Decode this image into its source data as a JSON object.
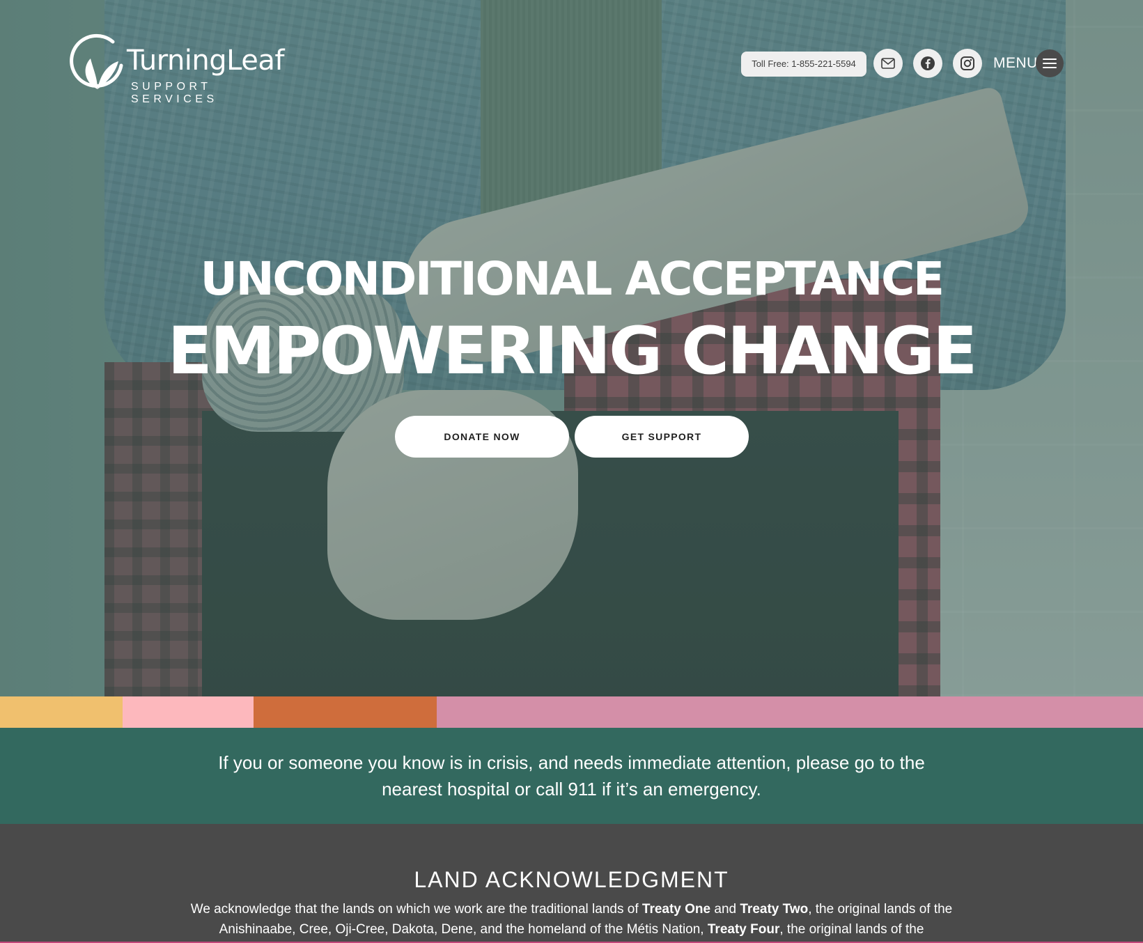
{
  "header": {
    "logo_name": "TurningLeaf",
    "logo_tagline": "SUPPORT SERVICES",
    "toll_free": "Toll Free: 1-855-221-5594",
    "icons": [
      "mail-icon",
      "facebook-icon",
      "instagram-icon"
    ],
    "menu_label": "MENU"
  },
  "hero": {
    "headline_1": "UNCONDITIONAL ACCEPTANCE",
    "headline_2": "EMPOWERING CHANGE",
    "donate_label": "DONATE NOW",
    "support_label": "GET SUPPORT"
  },
  "stripes": {
    "colors": [
      "#f0c06e",
      "#fdb8bd",
      "#cf6d3c",
      "#d48fa8"
    ]
  },
  "crisis": {
    "message": "If you or someone you know is in crisis, and needs immediate attention, please go to the nearest hospital or call 911 if it’s an emergency."
  },
  "land": {
    "title": "LAND ACKNOWLEDGMENT",
    "text_1": "We acknowledge that the lands on which we work are the traditional lands of ",
    "treaty_one": "Treaty One",
    "text_and": " and ",
    "treaty_two": "Treaty Two",
    "text_2": ", the original lands of the Anishinaabe, Cree, Oji-Cree, Dakota, Dene, and the homeland of the Métis Nation, ",
    "treaty_four": "Treaty Four",
    "text_3": ", the original lands of the"
  },
  "colors": {
    "crisis_bg": "#33695f",
    "land_bg": "#4a4a4a",
    "menu_button": "#4a4a4a"
  }
}
